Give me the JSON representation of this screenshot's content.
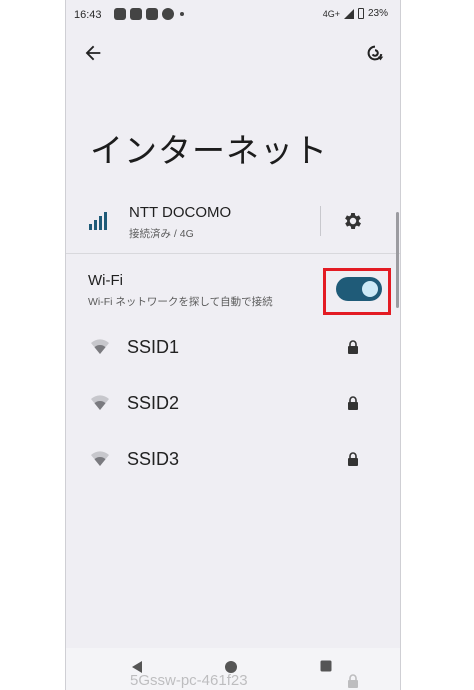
{
  "status_bar": {
    "time": "16:43",
    "network": "4G",
    "network_plus": "+",
    "battery": "23%"
  },
  "header": {
    "title": "インターネット"
  },
  "carrier": {
    "name": "NTT DOCOMO",
    "status": "接続済み / 4G"
  },
  "wifi": {
    "title": "Wi-Fi",
    "subtitle": "Wi-Fi ネットワークを探して自動で接続",
    "enabled": true
  },
  "networks": [
    {
      "ssid": "SSID1",
      "secured": true
    },
    {
      "ssid": "SSID2",
      "secured": true
    },
    {
      "ssid": "SSID3",
      "secured": true
    }
  ],
  "partial_network": {
    "ssid": "5Gssw-pc-461f23"
  },
  "colors": {
    "toggle_track": "#1f5b78",
    "toggle_knob": "#cdeaf7",
    "highlight": "#e31b23",
    "background": "#efeef3"
  },
  "icons": {
    "back": "arrow-left-icon",
    "sync": "sync-icon",
    "signal": "cellular-signal-icon",
    "settings": "gear-icon",
    "wifi": "wifi-icon",
    "lock": "lock-icon"
  }
}
